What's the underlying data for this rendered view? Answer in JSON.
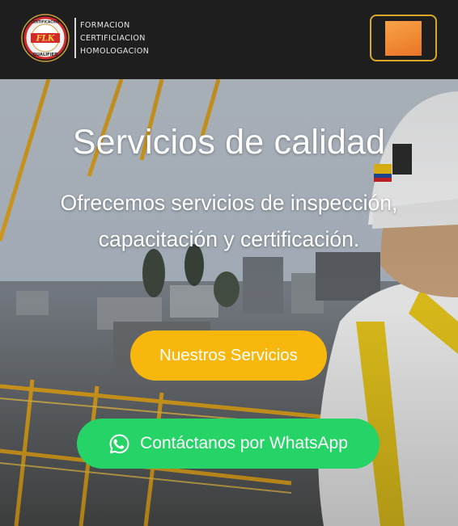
{
  "header": {
    "brand_lines": [
      "FORMACION",
      "CERTIFICIACION",
      "HOMOLOGACION"
    ],
    "logo_seal_text": {
      "top": "CERTIFICACION",
      "center": "FLK",
      "bottom": "QUALIFIED"
    },
    "menu_icon": "menu-toggle-square-icon"
  },
  "hero": {
    "title": "Servicios de calidad",
    "subtitle": "Ofrecemos servicios de inspección, capacitación y certificación.",
    "buttons": {
      "services_label": "Nuestros Servicios",
      "whatsapp_label": "Contáctanos por WhatsApp",
      "whatsapp_icon": "whatsapp-icon"
    }
  },
  "colors": {
    "header_bg": "#1e1e1e",
    "menu_border": "#d9a628",
    "menu_square": "#f08a33",
    "services_button": "#f7b70c",
    "whatsapp_button": "#25d366"
  }
}
